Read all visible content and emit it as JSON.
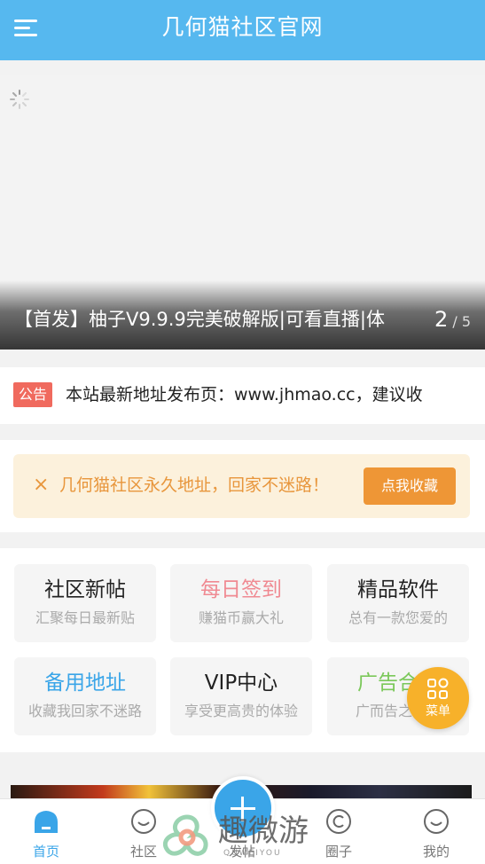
{
  "header": {
    "title": "几何猫社区官网",
    "menu_icon": "hamburger-menu-icon"
  },
  "banner": {
    "caption": "【首发】柚子V9.9.9完美破解版|可看直播|体",
    "page_current": "2",
    "page_rest": " / 5",
    "loading_icon": "spinner-icon"
  },
  "notice": {
    "tag": "公告",
    "text": "本站最新地址发布页：www.jhmao.cc，建议收"
  },
  "favor": {
    "close": "×",
    "text": "几何猫社区永久地址，回家不迷路！",
    "button": "点我收藏"
  },
  "cards": [
    {
      "title": "社区新帖",
      "subtitle": "汇聚每日最新贴",
      "color": "#222222"
    },
    {
      "title": "每日签到",
      "subtitle": "赚猫币赢大礼",
      "color": "#f08a92"
    },
    {
      "title": "精品软件",
      "subtitle": "总有一款您爱的",
      "color": "#222222"
    },
    {
      "title": "备用地址",
      "subtitle": "收藏我回家不迷路",
      "color": "#3aa5e8"
    },
    {
      "title": "VIP中心",
      "subtitle": "享受更高贵的体验",
      "color": "#222222"
    },
    {
      "title": "广告合作",
      "subtitle": "广而告之分享",
      "color": "#7bc85a"
    }
  ],
  "fab_menu": {
    "label": "菜单",
    "icon": "grid-menu-icon",
    "color": "#f7b12a"
  },
  "tabs": [
    {
      "label": "首页",
      "icon": "home-icon",
      "active": true
    },
    {
      "label": "社区",
      "icon": "chat-bubble-icon"
    },
    {
      "label": "发帖",
      "icon": "plus-icon"
    },
    {
      "label": "圈子",
      "icon": "circle-icon"
    },
    {
      "label": "我的",
      "icon": "smiley-icon"
    }
  ],
  "watermark": {
    "text": "趣微游",
    "sub": "QUWEIYOU"
  },
  "colors": {
    "primary": "#56b8ef",
    "accent_blue": "#3aa5e8",
    "orange": "#ee9636",
    "notice_red": "#f06a5e"
  }
}
